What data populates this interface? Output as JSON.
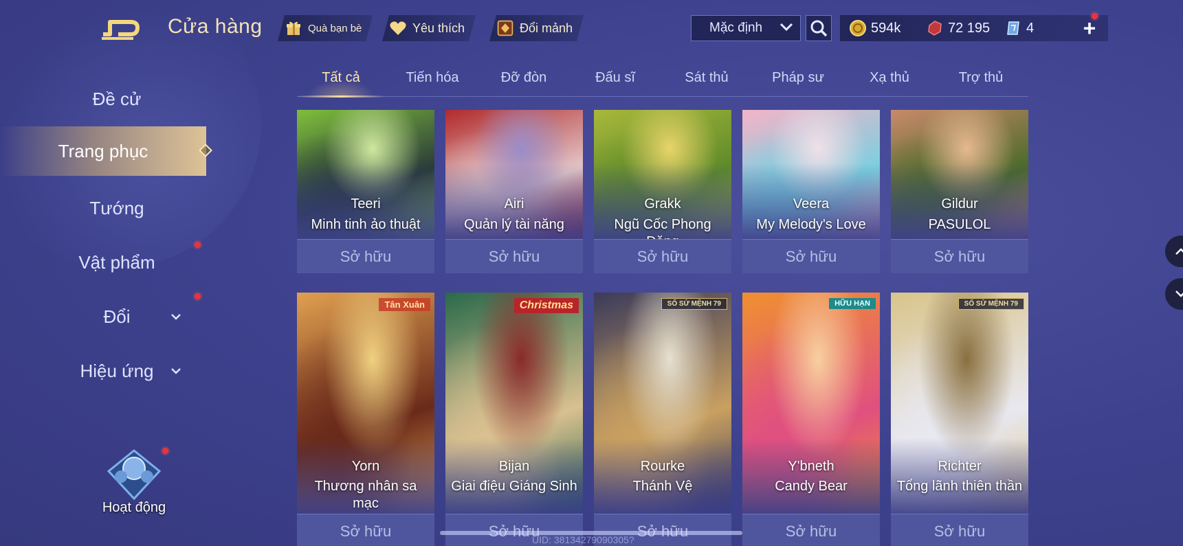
{
  "header": {
    "title": "Cửa hàng",
    "gift_label": "Quà bạn bè",
    "favorite_label": "Yêu thích",
    "exchange_label": "Đổi mảnh",
    "sort_value": "Mặc định",
    "gold": "594k",
    "vouchers": "72 195",
    "tickets": "4"
  },
  "tabs": [
    "Tất cả",
    "Tiến hóa",
    "Đỡ đòn",
    "Đấu sĩ",
    "Sát thủ",
    "Pháp sư",
    "Xạ thủ",
    "Trợ thủ"
  ],
  "sidebar": {
    "items": [
      "Đề cử",
      "Trang phục",
      "Tướng",
      "Vật phẩm",
      "Đổi",
      "Hiệu ứng"
    ],
    "activity_label": "Hoạt động"
  },
  "cards": [
    {
      "hero": "Teeri",
      "skin": "Minh tinh ảo thuật",
      "status": "Sở hữu",
      "colors": [
        "#7fbf3a",
        "#2a3a3a",
        "#cfe8a0"
      ]
    },
    {
      "hero": "Airi",
      "skin": "Quản lý tài năng",
      "status": "Sở hữu",
      "colors": [
        "#b22a2a",
        "#e3c7c9",
        "#9a8cc8"
      ]
    },
    {
      "hero": "Grakk",
      "skin": "Ngũ Cốc Phong Đăng",
      "status": "Sở hữu",
      "colors": [
        "#a8b83a",
        "#5e8a2a",
        "#e8d46a"
      ]
    },
    {
      "hero": "Veera",
      "skin": "My Melody's Love",
      "status": "Sở hữu",
      "colors": [
        "#f5b3c8",
        "#7ad0e0",
        "#f0e0e8"
      ]
    },
    {
      "hero": "Gildur",
      "skin": "PASULOL",
      "status": "Sở hữu",
      "colors": [
        "#c98a6a",
        "#4a6a2a",
        "#e6b890"
      ]
    },
    {
      "hero": "Yorn",
      "skin": "Thương nhân sa mạc",
      "status": "Sở hữu",
      "badge": "Tân Xuân",
      "colors": [
        "#e0a050",
        "#6a2a1a",
        "#f0d080"
      ]
    },
    {
      "hero": "Bijan",
      "skin": "Giai điệu Giáng Sinh",
      "status": "Sở hữu",
      "badge": "Christmas",
      "colors": [
        "#2a6a4a",
        "#d9c090",
        "#8a2a2a"
      ]
    },
    {
      "hero": "Rourke",
      "skin": "Thánh Vệ",
      "status": "Sở hữu",
      "badge": "SỐ SỨ MỆNH 79",
      "colors": [
        "#3a3a5a",
        "#c9a060",
        "#e6e0d0"
      ]
    },
    {
      "hero": "Y'bneth",
      "skin": "Candy Bear",
      "status": "Sở hữu",
      "badge": "HỮU HẠN",
      "colors": [
        "#f09030",
        "#e05080",
        "#f8d0a0"
      ]
    },
    {
      "hero": "Richter",
      "skin": "Tổng lãnh thiên thần",
      "status": "Sở hữu",
      "badge": "SỐ SỨ MỆNH 79",
      "colors": [
        "#d9c48a",
        "#e8e8f0",
        "#8a7040"
      ]
    }
  ],
  "uid_text": "UID: 38134279090305?"
}
